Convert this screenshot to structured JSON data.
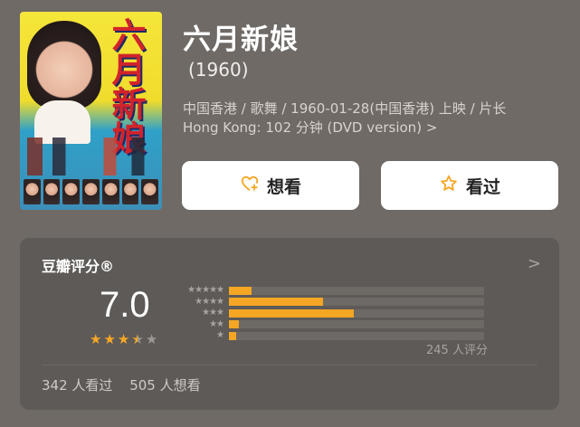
{
  "movie": {
    "title": "六月新娘",
    "year": "(1960)",
    "meta_line1": "中国香港 / 歌舞 / 1960-01-28(中国香港) 上映 / 片长",
    "meta_line2": "Hong Kong: 102 分钟 (DVD version)",
    "meta_chevron": ">",
    "poster_title_text": "六月新娘"
  },
  "actions": {
    "want_label": "想看",
    "seen_label": "看过"
  },
  "rating": {
    "source_label": "豆瓣评分®",
    "arrow": ">",
    "score": "7.0",
    "stars": 3.5,
    "rater_count": "245 人评分",
    "distribution": [
      {
        "stars": 5,
        "label": "★★★★★",
        "fraction": 0.09
      },
      {
        "stars": 4,
        "label": "★★★★",
        "fraction": 0.37
      },
      {
        "stars": 3,
        "label": "★★★",
        "fraction": 0.49
      },
      {
        "stars": 2,
        "label": "★★",
        "fraction": 0.04
      },
      {
        "stars": 1,
        "label": "★",
        "fraction": 0.03
      }
    ]
  },
  "stats": {
    "seen": "342 人看过",
    "want": "505 人想看"
  },
  "colors": {
    "background": "#6f6a66",
    "card": "#5e5a57",
    "accent": "#f5a623"
  }
}
